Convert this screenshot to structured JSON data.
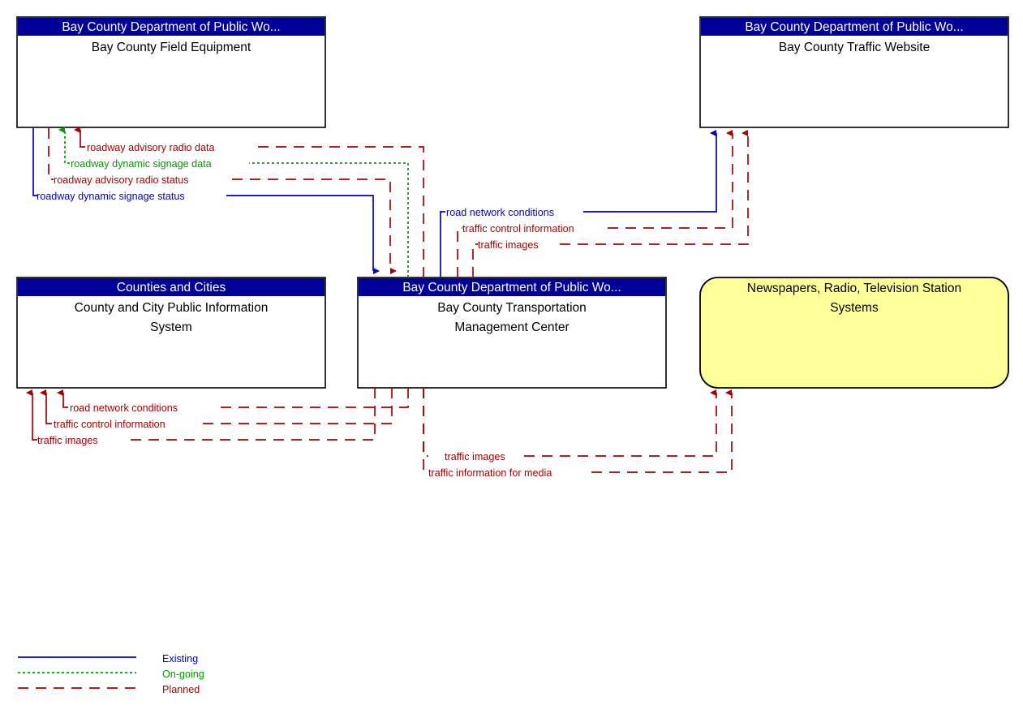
{
  "diagram": {
    "type": "interconnect-architecture-diagram",
    "boxes": [
      {
        "id": "field_equipment",
        "stereotype": "Bay County Department of Public Wo...",
        "name": "Bay County Field Equipment",
        "shape": "rect",
        "header_color": "#000099",
        "fill": "#ffffff"
      },
      {
        "id": "traffic_website",
        "stereotype": "Bay County Department of Public Wo...",
        "name": "Bay County Traffic Website",
        "shape": "rect",
        "header_color": "#000099",
        "fill": "#ffffff"
      },
      {
        "id": "county_city_pis",
        "stereotype": "Counties and Cities",
        "name": "County and City Public Information System",
        "shape": "rect",
        "header_color": "#000099",
        "fill": "#ffffff"
      },
      {
        "id": "tmc",
        "stereotype": "Bay County Department of Public Wo...",
        "name": "Bay County Transportation Management Center",
        "shape": "rect",
        "header_color": "#000099",
        "fill": "#ffffff"
      },
      {
        "id": "media",
        "stereotype": "",
        "name": "Newspapers, Radio, Television Station Systems",
        "shape": "rounded",
        "header_color": "",
        "fill": "#ffff99"
      }
    ],
    "flows": [
      {
        "label": "roadway advisory radio data",
        "status": "Planned",
        "color": "#aa0000",
        "from": "tmc",
        "to": "field_equipment"
      },
      {
        "label": "roadway dynamic signage data",
        "status": "On-going",
        "color": "#009900",
        "from": "tmc",
        "to": "field_equipment"
      },
      {
        "label": "roadway advisory radio status",
        "status": "Planned",
        "color": "#aa0000",
        "from": "field_equipment",
        "to": "tmc"
      },
      {
        "label": "roadway dynamic signage status",
        "status": "Existing",
        "color": "#0000cc",
        "from": "field_equipment",
        "to": "tmc"
      },
      {
        "label": "road network conditions",
        "status": "Existing",
        "color": "#0000cc",
        "from": "tmc",
        "to": "traffic_website"
      },
      {
        "label": "traffic control information",
        "status": "Planned",
        "color": "#aa0000",
        "from": "tmc",
        "to": "traffic_website"
      },
      {
        "label": "traffic images",
        "status": "Planned",
        "color": "#aa0000",
        "from": "tmc",
        "to": "traffic_website"
      },
      {
        "label": "road network conditions",
        "status": "Planned",
        "color": "#aa0000",
        "from": "tmc",
        "to": "county_city_pis"
      },
      {
        "label": "traffic control information",
        "status": "Planned",
        "color": "#aa0000",
        "from": "tmc",
        "to": "county_city_pis"
      },
      {
        "label": "traffic images",
        "status": "Planned",
        "color": "#aa0000",
        "from": "tmc",
        "to": "county_city_pis"
      },
      {
        "label": "traffic images",
        "status": "Planned",
        "color": "#aa0000",
        "from": "tmc",
        "to": "media"
      },
      {
        "label": "traffic information for media",
        "status": "Planned",
        "color": "#aa0000",
        "from": "tmc",
        "to": "media"
      }
    ]
  },
  "legend": {
    "items": [
      {
        "label": "Existing",
        "color": "#0000cc",
        "style": "solid"
      },
      {
        "label": "On-going",
        "color": "#009900",
        "style": "dotted"
      },
      {
        "label": "Planned",
        "color": "#aa0000",
        "style": "dashed"
      }
    ]
  }
}
